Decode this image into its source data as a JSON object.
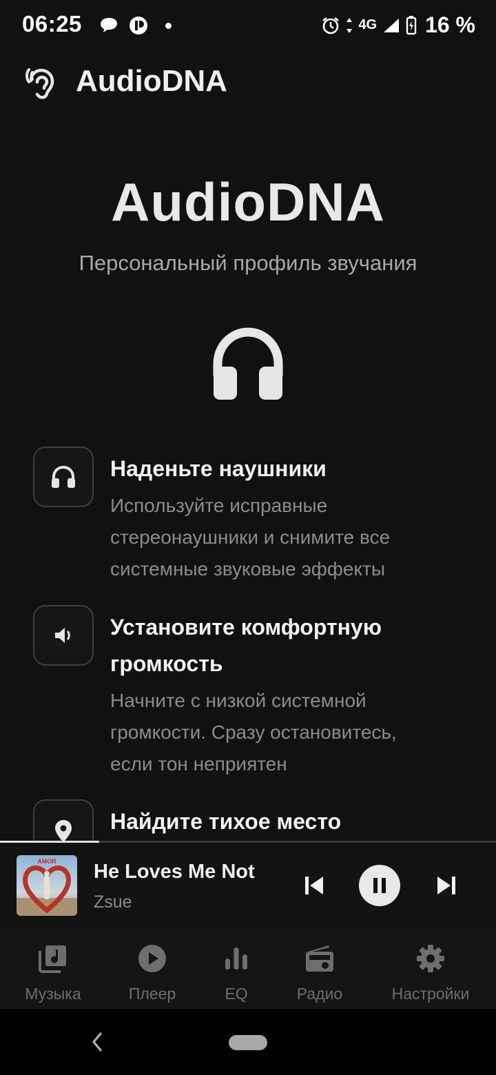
{
  "status_bar": {
    "time": "06:25",
    "network": "4G",
    "battery": "16 %"
  },
  "app_bar": {
    "title": "AudioDNA",
    "logo_icon": "ear-icon"
  },
  "hero": {
    "title": "AudioDNA",
    "subtitle": "Персональный профиль звучания",
    "icon": "headphones-icon"
  },
  "steps": [
    {
      "icon": "headphones-icon",
      "title": "Наденьте наушники",
      "description_lines": [
        "Используйте исправные",
        "стереонаушники и снимите все",
        "системные звуковые эффекты"
      ]
    },
    {
      "icon": "volume-icon",
      "title_lines": [
        "Установите комфортную",
        "громкость"
      ],
      "description_lines": [
        "Начните с низкой системной",
        "громкости. Сразу остановитесь,",
        "если тон неприятен"
      ]
    },
    {
      "icon": "location-pin-icon",
      "title": "Найдите тихое место"
    }
  ],
  "player": {
    "track_title": "He Loves Me Not",
    "artist": "Zsue",
    "progress_fraction": 0.2,
    "album_art_text": "AMOR",
    "state": "playing"
  },
  "bottom_nav": [
    {
      "label": "Музыка",
      "icon": "music-library-icon"
    },
    {
      "label": "Плеер",
      "icon": "play-circle-icon"
    },
    {
      "label": "EQ",
      "icon": "equalizer-icon"
    },
    {
      "label": "Радио",
      "icon": "radio-icon"
    },
    {
      "label": "Настройки",
      "icon": "settings-gear-icon"
    }
  ],
  "colors": {
    "background": "#111111",
    "text_primary": "#f2f2f2",
    "text_secondary": "#8c8c8c",
    "nav_inactive": "#6e6e6e"
  }
}
